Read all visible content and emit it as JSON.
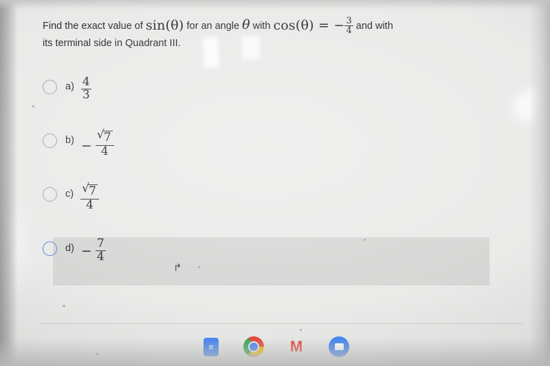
{
  "question": {
    "lead": "Find the exact value of",
    "func_sin": "sin(θ)",
    "mid1": "for an angle",
    "theta": "θ",
    "mid2": "with",
    "func_cos": "cos(θ) = −",
    "cos_value_num": "3",
    "cos_value_den": "4",
    "tail": "and with",
    "line2": "its terminal side in Quadrant III."
  },
  "options": [
    {
      "letter": "a)",
      "value": "4/3",
      "numerator": "4",
      "denominator": "3",
      "sign": "",
      "radical": false,
      "selected": false
    },
    {
      "letter": "b)",
      "value": "-√7/4",
      "numerator": "7",
      "denominator": "4",
      "sign": "−",
      "radical": true,
      "selected": false
    },
    {
      "letter": "c)",
      "value": "√7/4",
      "numerator": "7",
      "denominator": "4",
      "sign": "",
      "radical": true,
      "selected": false
    },
    {
      "letter": "d)",
      "value": "-7/4",
      "numerator": "7",
      "denominator": "4",
      "sign": "−",
      "radical": false,
      "selected": true
    }
  ],
  "cursor": {
    "glyph": "↱"
  },
  "shelf": {
    "items": [
      {
        "name": "docs-icon",
        "label": ""
      },
      {
        "name": "chrome-icon",
        "label": ""
      },
      {
        "name": "gmail-icon",
        "label": "M"
      },
      {
        "name": "messages-icon",
        "label": ""
      }
    ]
  },
  "colors": {
    "background": "#e9eae8",
    "highlight": "#d5d6d4",
    "accent": "#5b7fd4",
    "text": "#222426"
  }
}
